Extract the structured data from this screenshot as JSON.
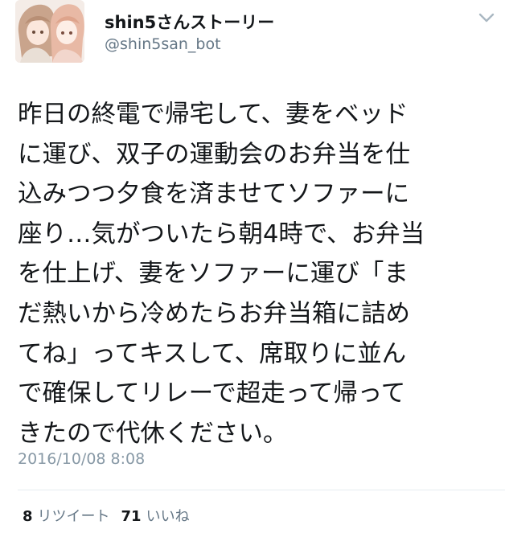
{
  "author": {
    "display_name": "shin5さんストーリー",
    "handle": "@shin5san_bot"
  },
  "icons": {
    "avatar": "anime-couple-avatar",
    "menu": "chevron-down-icon"
  },
  "tweet": {
    "lines": [
      "昨日の終電で帰宅して、妻をベッド",
      "に運び、双子の運動会のお弁当を仕",
      "込みつつ夕食を済ませてソファーに",
      "座り…気がついたら朝4時で、お弁当",
      "を仕上げ、妻をソファーに運び「ま",
      "だ熱いから冷めたらお弁当箱に詰め",
      "てね」ってキスして、席取りに並ん",
      "で確保してリレーで超走って帰って",
      "きたので代休ください。"
    ],
    "timestamp": "2016/10/08 8:08"
  },
  "stats": {
    "retweets_count": "8",
    "retweets_label": "リツイート",
    "likes_count": "71",
    "likes_label": "いいね"
  },
  "colors": {
    "text": "#14171a",
    "secondary": "#657786",
    "timestamp": "#8899a6",
    "divider": "#e6ecf0"
  }
}
